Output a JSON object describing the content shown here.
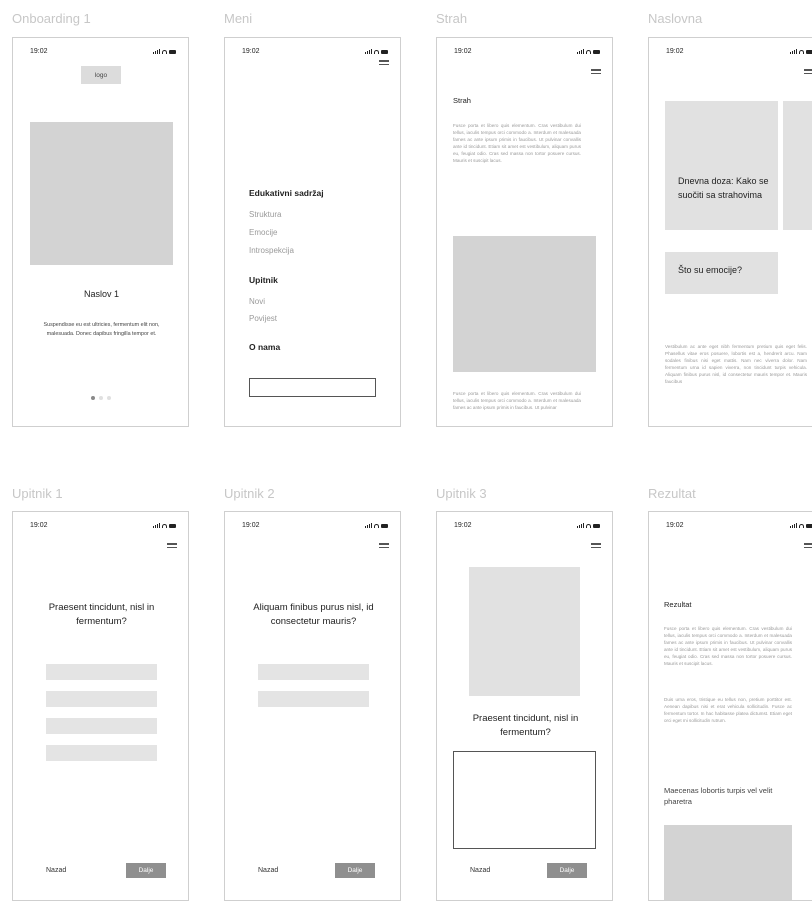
{
  "status_time": "19:02",
  "frames": {
    "onboarding": {
      "title": "Onboarding 1",
      "logo": "logo",
      "heading": "Naslov 1",
      "text": "Suspendisse eu est ultricies, fermentum elit non, malesuada. Donec dapibus fringilla tempor et."
    },
    "meni": {
      "title": "Meni",
      "section1": "Edukativni sadržaj",
      "items1": [
        "Struktura",
        "Emocije",
        "Introspekcija"
      ],
      "section2": "Upitnik",
      "items2": [
        "Novi",
        "Povijest"
      ],
      "section3": "O nama"
    },
    "strah": {
      "title": "Strah",
      "heading": "Strah",
      "text1": "Fusce porta et libero quis elementum. Cras vestibulum dui tellus, iaculis tempus orci commodo a. Interdum et malesuada fames ac ante ipsum primis in faucibus. Ut pulvinar convallis ante id tincidunt. Etiam sit amet est vestibulum, aliquam purus eu, feugiat odio. Cras sed massa non tortor posuere cursus. Mauris et suscipit lacus.",
      "text2": "Fusce porta et libero quis elementum. Cras vestibulum dui tellus, iaculis tempus orci commodo a. Interdum et malesuada fames ac ante ipsum primis in faucibus. Ut pulvinar"
    },
    "naslovna": {
      "title": "Naslovna",
      "card1": "Dnevna doza: Kako se suočiti sa strahovima",
      "card2": "Što su emocije?",
      "text": "Vestibulum ac ante eget nibh fermentum pretium quis eget felis. Phasellus vitae eros posuere, lobortis est a, hendrerit arcu. Nam sodales finibus nisi eget mattis. Nam nec viverra dolor. Nam fermentum urna id sapien viverra, non tincidunt turpis vehicula. Aliquam finibus purus nisl, id consectetur mauris tempor et. Mauris faucibus"
    },
    "upitnik1": {
      "title": "Upitnik 1",
      "question": "Praesent tincidunt, nisl in fermentum?",
      "back": "Nazad",
      "next": "Dalje"
    },
    "upitnik2": {
      "title": "Upitnik 2",
      "question": "Aliquam finibus purus nisl, id consectetur mauris?",
      "back": "Nazad",
      "next": "Dalje"
    },
    "upitnik3": {
      "title": "Upitnik 3",
      "question": "Praesent tincidunt, nisl in fermentum?",
      "back": "Nazad",
      "next": "Dalje"
    },
    "rezultat": {
      "title": "Rezultat",
      "heading": "Rezultat",
      "text1": "Fusce porta et libero quis elementum. Cras vestibulum dui tellus, iaculis tempus orci commodo a. Interdum et malesuada fames ac ante ipsum primis in faucibus. Ut pulvinar convallis ante id tincidunt. Etiam sit amet est vestibulum, aliquam purus eu, feugiat odio. Cras sed massa non tortor posuere cursus. Mauris et suscipit lacus.",
      "text2": "Duis urna eros, tristique eu tellus non, pretium porttitor est. Aenean dapibus nisi et erat vehicula sollicitudin. Fusce ac fermentum tortor. In hac habitasse platea dictumst. Etiam eget orci eget mi sollicitudin rutrum.",
      "subheading": "Maecenas lobortis turpis vel velit pharetra"
    }
  }
}
